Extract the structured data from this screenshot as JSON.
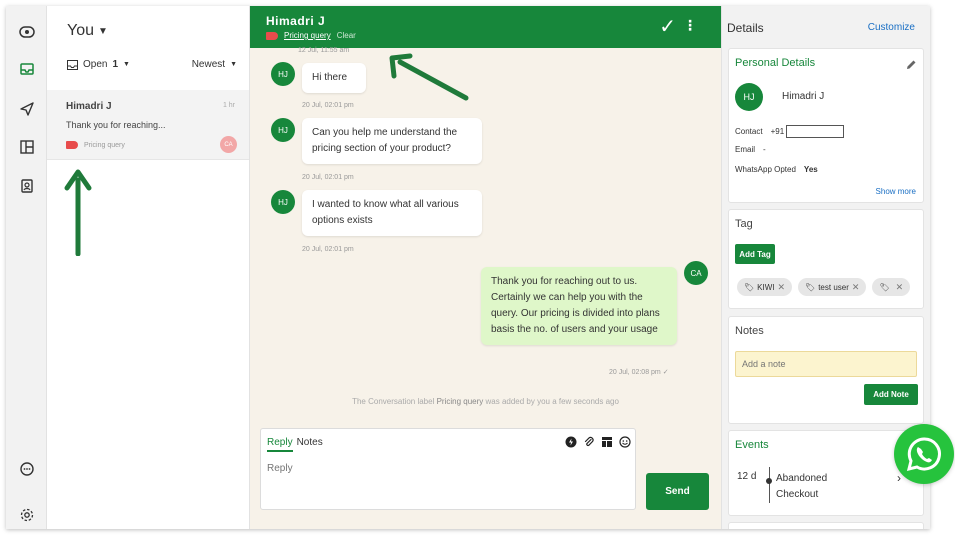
{
  "list": {
    "title": "You",
    "status_filter": "Open",
    "status_count": "1",
    "sort": "Newest"
  },
  "conversation": {
    "name": "Himadri J",
    "time": "1 hr",
    "preview": "Thank you for reaching...",
    "label": "Pricing query",
    "assignee_initials": "CA"
  },
  "chat": {
    "contact_name": "Himadri J",
    "label": "Pricing query",
    "clear": "Clear",
    "top_time": "12 Jul, 11:55 am",
    "messages": [
      {
        "from": "HJ",
        "text": "Hi there",
        "time": "20 Jul, 02:01 pm"
      },
      {
        "from": "HJ",
        "text": "Can you help me understand the pricing section of your product?",
        "time": "20 Jul, 02:01 pm"
      },
      {
        "from": "HJ",
        "text": "I wanted to know what all various options exists",
        "time": "20 Jul, 02:01 pm"
      },
      {
        "from": "CA",
        "text": "Thank you for reaching out to us. Certainly we can help you with the query. Our pricing is divided into plans basis the no. of users and your usage",
        "time": "20 Jul, 02:08 pm"
      }
    ],
    "system_prefix": "The Conversation label ",
    "system_label": "Pricing query",
    "system_suffix": " was added by you a few seconds ago",
    "reply_tab": "Reply",
    "notes_tab": "Notes",
    "reply_placeholder": "Reply",
    "send_label": "Send"
  },
  "details": {
    "title": "Details",
    "customize": "Customize",
    "personal": {
      "title": "Personal Details",
      "initials": "HJ",
      "name": "Himadri J",
      "contact_label": "Contact",
      "contact_value": "+91",
      "email_label": "Email",
      "email_value": "-",
      "whatsapp_label": "WhatsApp Opted",
      "whatsapp_value": "Yes",
      "show_more": "Show more"
    },
    "tag": {
      "title": "Tag",
      "add_label": "Add Tag",
      "chips": [
        "KIWI",
        "test user",
        ""
      ]
    },
    "notes": {
      "title": "Notes",
      "placeholder": "Add a note",
      "add_label": "Add Note"
    },
    "events": {
      "title": "Events",
      "age": "12 d",
      "event_line1": "Abandoned",
      "event_line2": "Checkout"
    }
  },
  "colors": {
    "brand_green": "#17873b",
    "whatsapp_green": "#26c33d",
    "label_red": "#e84c4c",
    "link_blue": "#1a6fc4"
  }
}
